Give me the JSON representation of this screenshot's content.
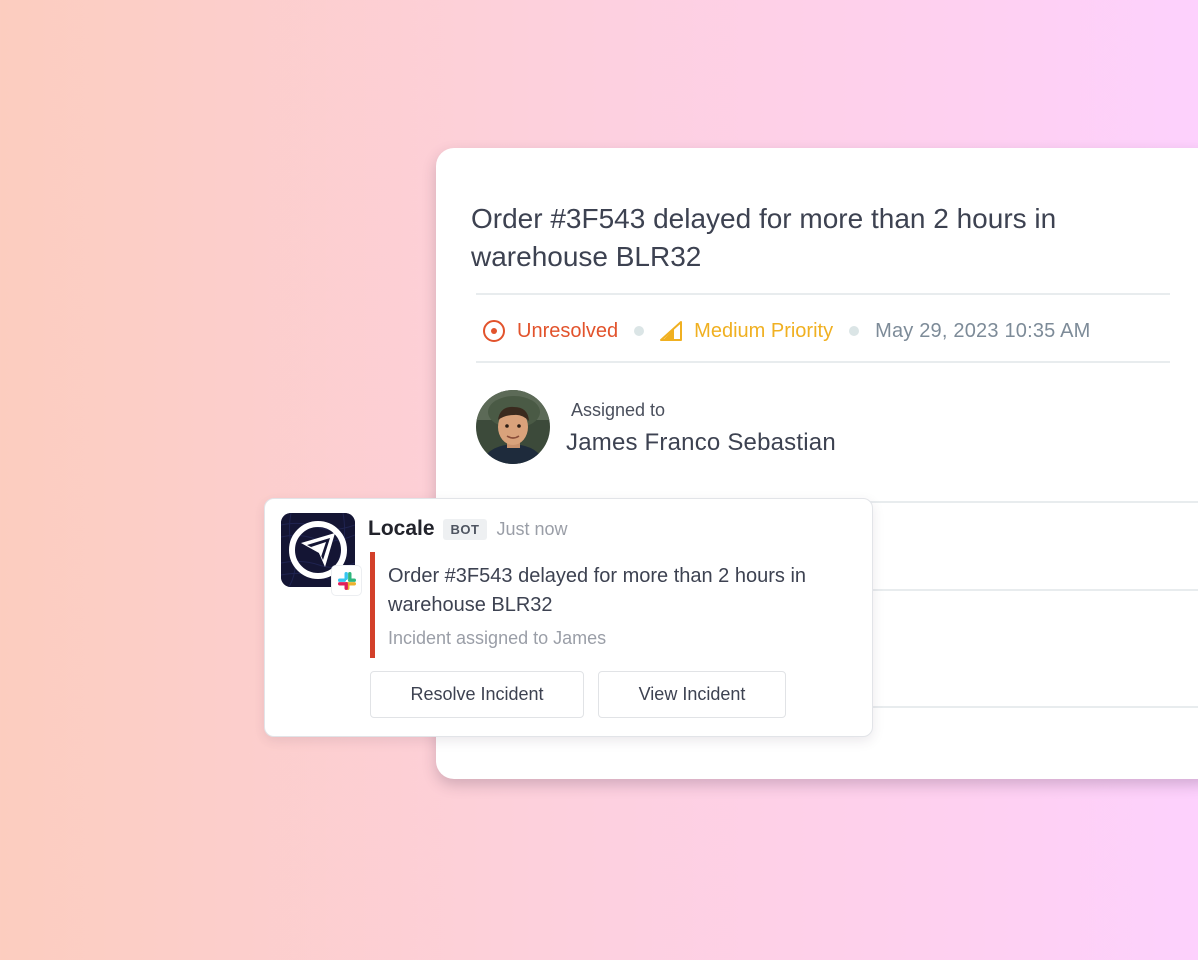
{
  "incident": {
    "title": "Order #3F543 delayed for more than 2 hours in warehouse BLR32",
    "status": "Unresolved",
    "priority": "Medium Priority",
    "timestamp": "May 29, 2023 10:35 AM",
    "assigned_label": "Assigned to",
    "assignee_name": "James Franco Sebastian"
  },
  "message": {
    "bot_name": "Locale",
    "bot_tag": "BOT",
    "time": "Just now",
    "title": "Order #3F543 delayed for more than 2 hours in warehouse BLR32",
    "subtitle": "Incident assigned to James",
    "actions": {
      "resolve_label": "Resolve Incident",
      "view_label": "View Incident"
    }
  },
  "icons": {
    "status": "target-icon",
    "priority": "signal-icon",
    "app": "locale-logo",
    "integration": "slack-icon"
  },
  "colors": {
    "status": "#e2532c",
    "priority": "#f0b021",
    "accent_bar": "#d3402a"
  }
}
